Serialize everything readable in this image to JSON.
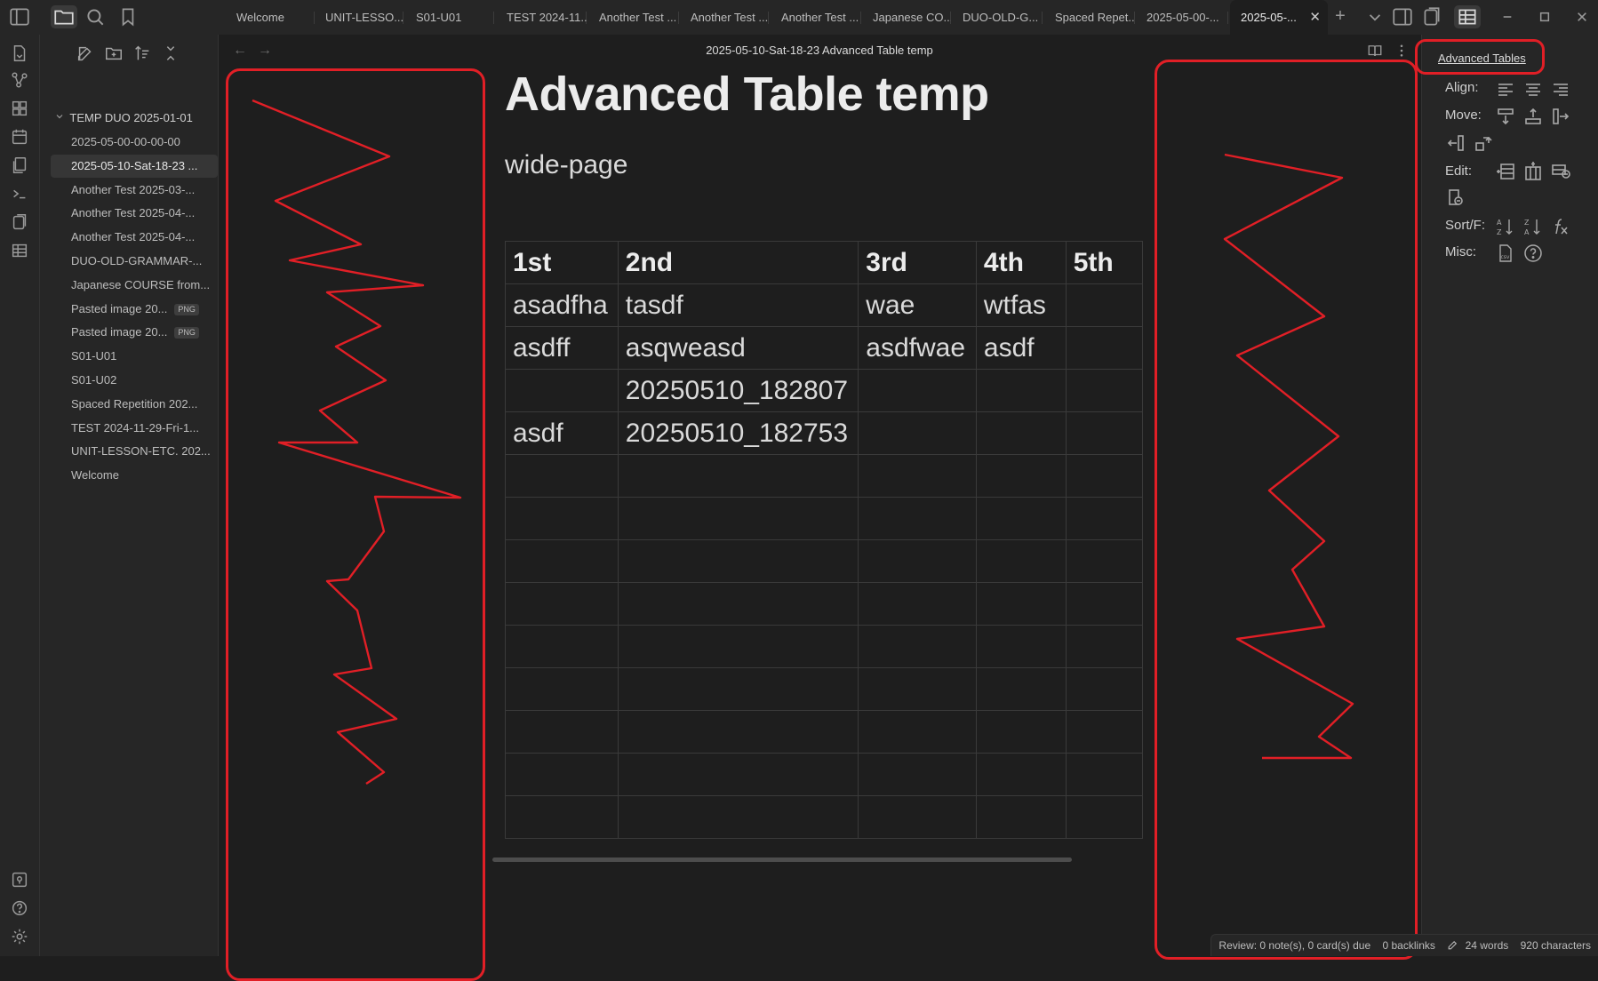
{
  "tabs": [
    {
      "label": "Welcome"
    },
    {
      "label": "UNIT-LESSO..."
    },
    {
      "label": "S01-U01"
    },
    {
      "label": "TEST 2024-11..."
    },
    {
      "label": "Another Test ..."
    },
    {
      "label": "Another Test ..."
    },
    {
      "label": "Another Test ..."
    },
    {
      "label": "Japanese CO..."
    },
    {
      "label": "DUO-OLD-G..."
    },
    {
      "label": "Spaced Repet..."
    },
    {
      "label": "2025-05-00-..."
    },
    {
      "label": "2025-05-..."
    }
  ],
  "tab_close_glyph": "✕",
  "new_tab_glyph": "+",
  "explorer": {
    "folder": "TEMP DUO 2025-01-01",
    "items": [
      {
        "label": "2025-05-00-00-00-00"
      },
      {
        "label": "2025-05-10-Sat-18-23 ..."
      },
      {
        "label": "Another Test 2025-03-..."
      },
      {
        "label": "Another Test 2025-04-..."
      },
      {
        "label": "Another Test 2025-04-..."
      },
      {
        "label": "DUO-OLD-GRAMMAR-..."
      },
      {
        "label": "Japanese COURSE from..."
      },
      {
        "label": "Pasted image 20...",
        "badge": "PNG"
      },
      {
        "label": "Pasted image 20...",
        "badge": "PNG"
      },
      {
        "label": "S01-U01"
      },
      {
        "label": "S01-U02"
      },
      {
        "label": "Spaced Repetition 202..."
      },
      {
        "label": "TEST 2024-11-29-Fri-1..."
      },
      {
        "label": "UNIT-LESSON-ETC. 202..."
      },
      {
        "label": "Welcome"
      }
    ]
  },
  "editor": {
    "view_title": "2025-05-10-Sat-18-23 Advanced Table temp",
    "back_glyph": "←",
    "forward_glyph": "→",
    "title": "Advanced Table temp",
    "subtitle": "wide-page",
    "table": {
      "headers": [
        "1st",
        "2nd",
        "3rd",
        "4th",
        "5th"
      ],
      "rows": [
        [
          "asadfha",
          "tasdf",
          "wae",
          "wtfas",
          ""
        ],
        [
          "asdff",
          "asqweasd",
          "asdfwae",
          "asdf",
          ""
        ],
        [
          "",
          "20250510_182807",
          "",
          "",
          ""
        ],
        [
          "asdf",
          "20250510_182753",
          "",
          "",
          ""
        ],
        [
          "",
          "",
          "",
          "",
          ""
        ],
        [
          "",
          "",
          "",
          "",
          ""
        ],
        [
          "",
          "",
          "",
          "",
          ""
        ],
        [
          "",
          "",
          "",
          "",
          ""
        ],
        [
          "",
          "",
          "",
          "",
          ""
        ],
        [
          "",
          "",
          "",
          "",
          ""
        ],
        [
          "",
          "",
          "",
          "",
          ""
        ],
        [
          "",
          "",
          "",
          "",
          ""
        ],
        [
          "",
          "",
          "",
          "",
          ""
        ]
      ]
    }
  },
  "advanced_tables": {
    "title": "Advanced Tables",
    "align_label": "Align:",
    "move_label": "Move:",
    "edit_label": "Edit:",
    "sort_label": "Sort/F:",
    "misc_label": "Misc:"
  },
  "status": {
    "review": "Review: 0 note(s), 0 card(s) due",
    "backlinks": "0 backlinks",
    "words": "24 words",
    "characters": "920 characters"
  },
  "colors": {
    "annotation_red": "#e11f26",
    "background": "#1e1e1e",
    "panel": "#262626"
  }
}
